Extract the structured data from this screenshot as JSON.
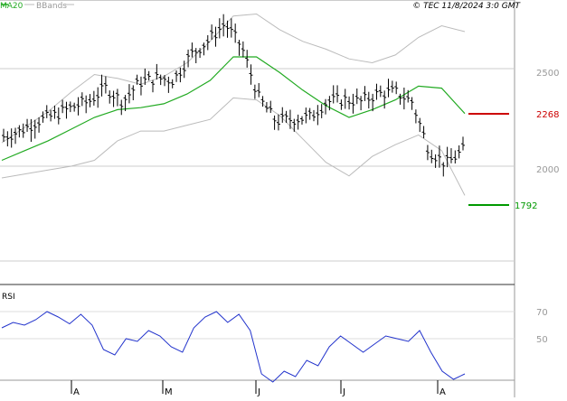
{
  "header": {
    "ma_label": "MA20",
    "bbands_label": "BBands",
    "copyright": "© TEC 11/8/2024 3:0 GMT"
  },
  "price_axis": {
    "ticks": [
      "2500",
      "2000"
    ]
  },
  "levels": [
    {
      "label": "2268",
      "value": 2268,
      "color": "#cc0000"
    },
    {
      "label": "1792",
      "value": 1792,
      "color": "#009900"
    }
  ],
  "rsi_panel": {
    "label": "RSI",
    "ticks": [
      "70",
      "50"
    ]
  },
  "month_labels": [
    "A",
    "M",
    "J",
    "J",
    "A"
  ],
  "colors": {
    "ma": "#22aa22",
    "bbands": "#bbbbbb",
    "rsi": "#2233cc",
    "bars": "#000000",
    "grid": "#cccccc"
  },
  "chart_data": {
    "type": "line",
    "title": "",
    "ylim": [
      1500,
      2800
    ],
    "series": [
      {
        "name": "MA20",
        "x": [
          0,
          5,
          10,
          15,
          20,
          25,
          30,
          35,
          40,
          45,
          50,
          55,
          60,
          65,
          70,
          75,
          80,
          85,
          90,
          95,
          100
        ],
        "values": [
          2030,
          2080,
          2130,
          2190,
          2250,
          2290,
          2300,
          2320,
          2370,
          2440,
          2560,
          2560,
          2480,
          2390,
          2310,
          2250,
          2290,
          2340,
          2410,
          2400,
          2270
        ]
      },
      {
        "name": "BBands",
        "x": [
          0,
          5,
          10,
          15,
          20,
          25,
          30,
          35,
          40,
          45,
          50,
          55,
          60,
          65,
          70,
          75,
          80,
          85,
          90,
          95,
          100
        ],
        "values": [
          2120,
          2200,
          2280,
          2380,
          2470,
          2450,
          2420,
          2460,
          2530,
          2640,
          2770,
          2780,
          2700,
          2640,
          2600,
          2550,
          2530,
          2570,
          2660,
          2720,
          2690
        ]
      }
    ],
    "ohlc_close": [
      2150,
      2180,
      2230,
      2260,
      2300,
      2330,
      2400,
      2330,
      2430,
      2450,
      2440,
      2570,
      2640,
      2730,
      2610,
      2350,
      2230,
      2240,
      2250,
      2330,
      2340,
      2330,
      2370,
      2380,
      2330,
      2080,
      2010,
      2080
    ],
    "rsi": [
      58,
      62,
      60,
      64,
      70,
      66,
      61,
      68,
      60,
      42,
      38,
      50,
      48,
      56,
      52,
      44,
      40,
      58,
      66,
      70,
      62,
      68,
      56,
      24,
      18,
      26,
      22,
      34,
      30,
      44,
      52,
      46,
      40,
      46,
      52,
      50,
      48,
      56,
      40,
      26,
      20,
      24
    ]
  }
}
